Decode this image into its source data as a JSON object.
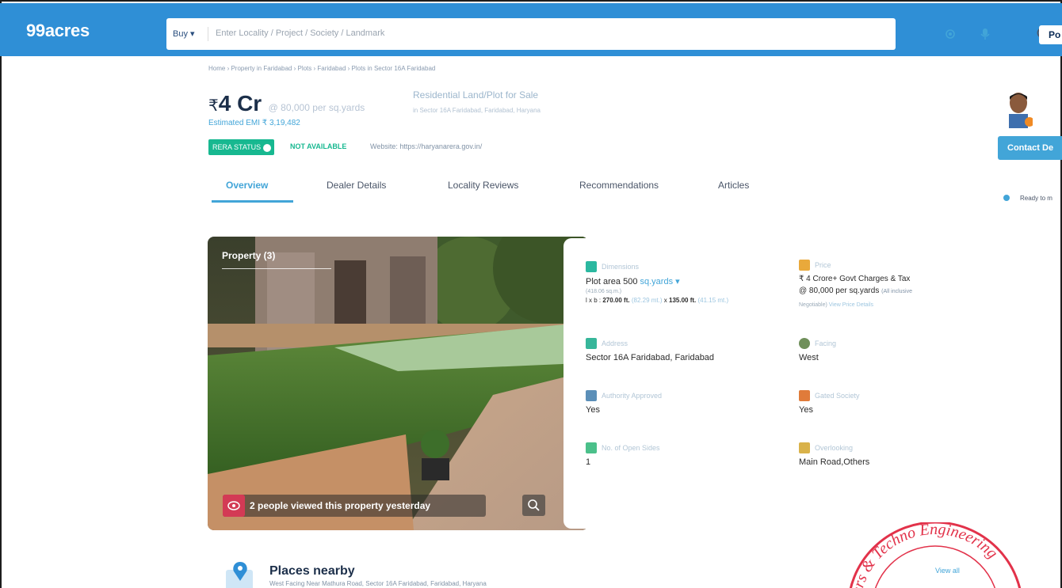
{
  "header": {
    "logo": "99acres",
    "buy_label": "Buy ▾",
    "search_placeholder": "Enter Locality / Project / Society / Landmark",
    "post_label": "Po",
    "colors": {
      "brand": "#2f8fd6",
      "accent": "#42a5d8",
      "rera": "#17b890"
    }
  },
  "breadcrumb": "Home › Property in Faridabad › Plots › Faridabad › Plots in Sector 16A Faridabad",
  "listing": {
    "price_symbol": "₹",
    "price_amount": "4 Cr",
    "price_per": "@ 80,000 per sq.yards",
    "emi": "Estimated EMI ₹ 3,19,482",
    "type": "Residential Land/Plot for Sale",
    "address": "in Sector 16A Faridabad, Faridabad, Haryana",
    "rera_label": "RERA STATUS",
    "rera_value": "NOT AVAILABLE",
    "rera_website": "Website: https://haryanarera.gov.in/"
  },
  "tabs": [
    {
      "label": "Overview"
    },
    {
      "label": "Dealer Details"
    },
    {
      "label": "Locality Reviews"
    },
    {
      "label": "Recommendations"
    },
    {
      "label": "Articles"
    }
  ],
  "photo": {
    "title": "Property (3)",
    "views_text": "2 people viewed this property yesterday"
  },
  "details": {
    "dimensions": {
      "label": "Dimensions",
      "value_prefix": "Plot area 500",
      "unit": "sq.yards ▾",
      "sub": "(418.06 sq.m.)",
      "lxb_prefix": "l x b :",
      "length": "270.00 ft.",
      "length_m": "(82.29 mt.)",
      "by": "x",
      "breadth": "135.00 ft.",
      "breadth_m": "(41.15 mt.)"
    },
    "price": {
      "label": "Price",
      "value": "₹ 4 Crore+ Govt Charges & Tax",
      "per": "@ 80,000 per sq.yards",
      "inclusive": "(All inclusive",
      "negotiable": "Negotiable)",
      "details_link": "View Price Details"
    },
    "address": {
      "label": "Address",
      "value": "Sector 16A Faridabad, Faridabad"
    },
    "facing": {
      "label": "Facing",
      "value": "West"
    },
    "authority": {
      "label": "Authority Approved",
      "value": "Yes"
    },
    "gated": {
      "label": "Gated Society",
      "value": "Yes"
    },
    "open_sides": {
      "label": "No. of Open Sides",
      "value": "1"
    },
    "overlooking": {
      "label": "Overlooking",
      "value": "Main Road,Others"
    }
  },
  "agent": {
    "contact_label": "Contact De",
    "ready_text": "Ready to m"
  },
  "places": {
    "title": "Places nearby",
    "subtitle": "West Facing Near Mathura Road, Sector 16A Faridabad, Faridabad, Haryana"
  },
  "stamp": {
    "text": "ers & Techno Engineering",
    "link": "View all"
  }
}
